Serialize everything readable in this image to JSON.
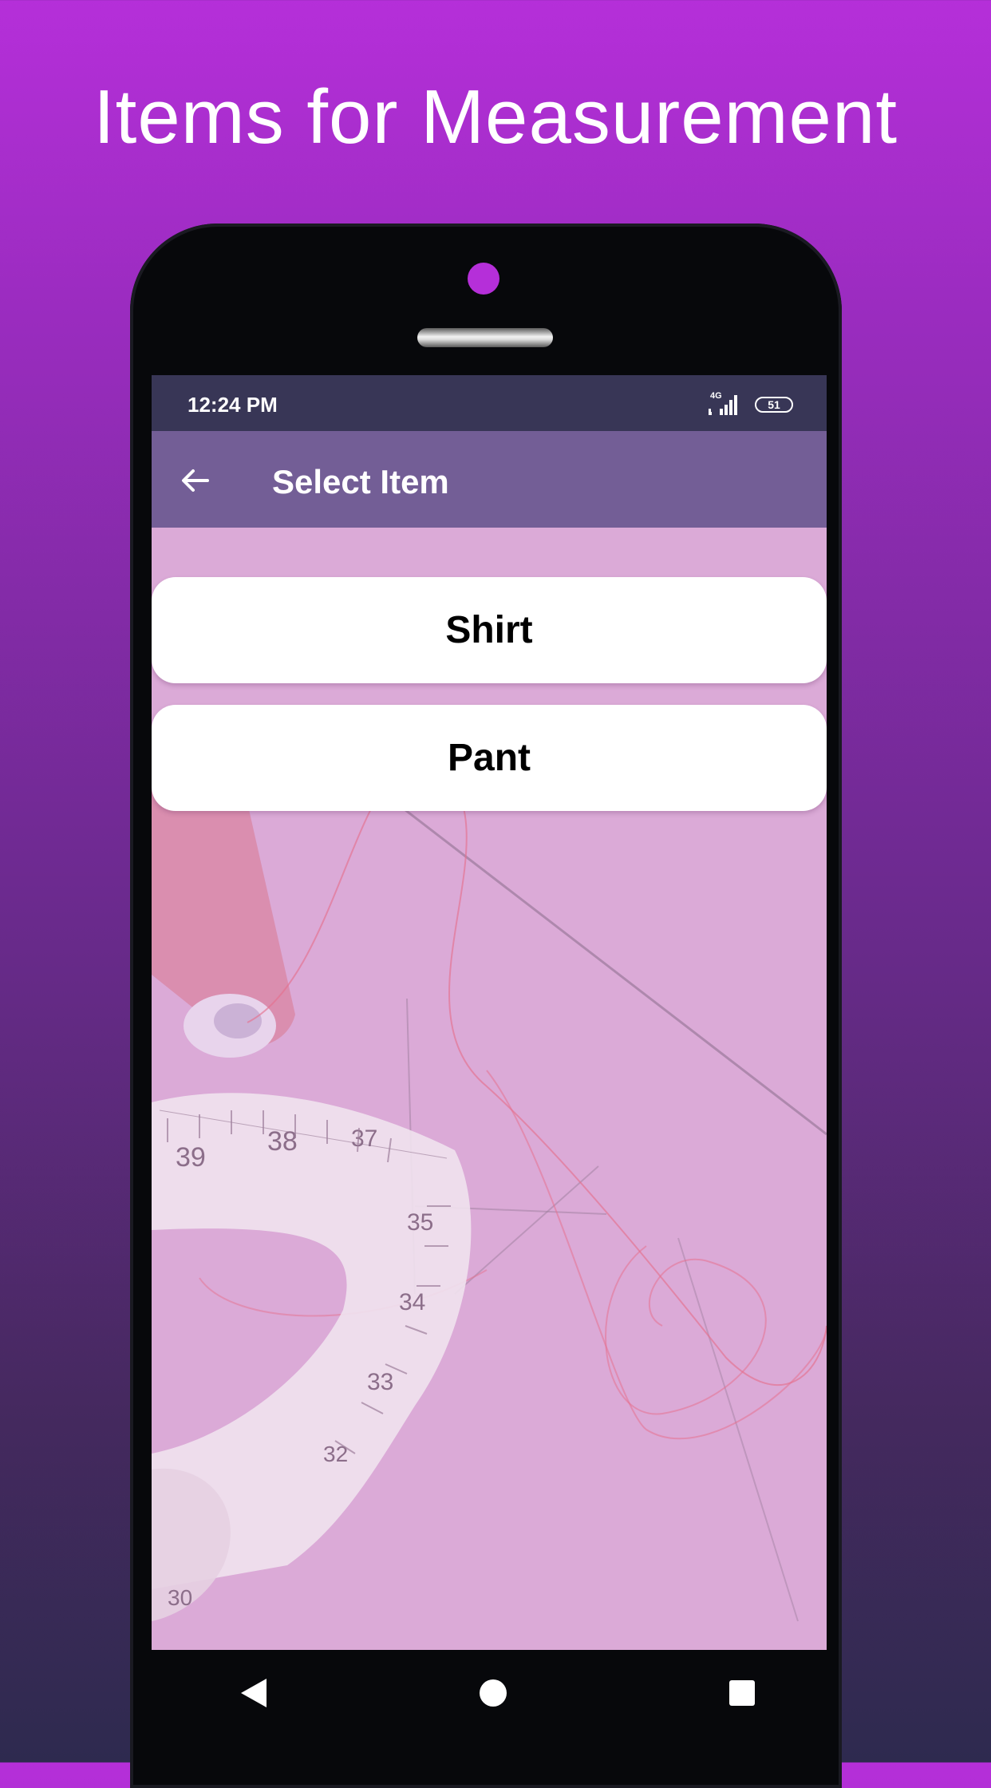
{
  "promo": {
    "title": "Items for Measurement"
  },
  "status_bar": {
    "time": "12:24 PM",
    "network": "4G",
    "battery": "51"
  },
  "app_bar": {
    "title": "Select Item"
  },
  "items": [
    {
      "label": "Shirt"
    },
    {
      "label": "Pant"
    }
  ],
  "tape_numbers": [
    "39",
    "38",
    "37",
    "35",
    "34",
    "33",
    "32",
    "30"
  ],
  "icons": {
    "back": "arrow-left-icon",
    "nav_back": "triangle-back-icon",
    "nav_home": "circle-home-icon",
    "nav_recents": "square-recents-icon"
  },
  "colors": {
    "accent": "#b52fd9",
    "app_bar": "#735e96",
    "status_bar": "#383656",
    "screen_bg": "#dbaad7",
    "button_bg": "#ffffff"
  }
}
